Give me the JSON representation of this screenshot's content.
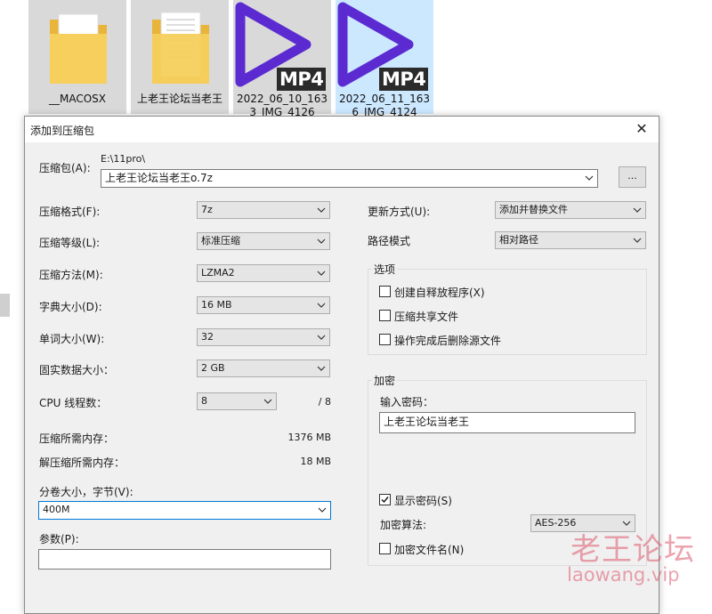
{
  "explorer": {
    "files": [
      {
        "name": "__MACOSX",
        "type": "folder-icon"
      },
      {
        "name": "上老王论坛当老王",
        "type": "folder-icon"
      },
      {
        "name": "2022_06_10_1633_IMG_4126",
        "type": "video-file-icon",
        "badge": "MP4"
      },
      {
        "name": "2022_06_11_1636_IMG_4124",
        "type": "video-file-icon",
        "badge": "MP4"
      }
    ]
  },
  "dialog": {
    "title": "添加到压缩包",
    "close_glyph": "✕",
    "archive": {
      "label": "压缩包(A):",
      "path": "E:\\11pro\\",
      "filename": "上老王论坛当老王o.7z",
      "browse_label": "..."
    },
    "left": {
      "format": {
        "label": "压缩格式(F):",
        "value": "7z"
      },
      "level": {
        "label": "压缩等级(L):",
        "value": "标准压缩"
      },
      "method": {
        "label": "压缩方法(M):",
        "value": "LZMA2"
      },
      "dict": {
        "label": "字典大小(D):",
        "value": "16 MB"
      },
      "word": {
        "label": "单词大小(W):",
        "value": "32"
      },
      "solid": {
        "label": "固实数据大小：",
        "value": "2 GB"
      },
      "threads": {
        "label": "CPU 线程数：",
        "value": "8",
        "max": "/ 8"
      },
      "mem_compress": {
        "label": "压缩所需内存：",
        "value": "1376 MB"
      },
      "mem_decompress": {
        "label": "解压缩所需内存：",
        "value": "18 MB"
      },
      "split": {
        "label": "分卷大小，字节(V):",
        "value": "400M"
      },
      "params": {
        "label": "参数(P):",
        "value": ""
      }
    },
    "right": {
      "update": {
        "label": "更新方式(U):",
        "value": "添加并替换文件"
      },
      "path_mode": {
        "label": "路径模式",
        "value": "相对路径"
      },
      "options": {
        "title": "选项",
        "items": [
          {
            "label": "创建自释放程序(X)",
            "checked": false
          },
          {
            "label": "压缩共享文件",
            "checked": false
          },
          {
            "label": "操作完成后删除源文件",
            "checked": false
          }
        ]
      },
      "encryption": {
        "title": "加密",
        "password_label": "输入密码：",
        "password": "上老王论坛当老王",
        "show_password": {
          "label": "显示密码(S)",
          "checked": true
        },
        "method_label": "加密算法:",
        "method_value": "AES-256",
        "encrypt_names": {
          "label": "加密文件名(N)",
          "checked": false
        }
      }
    }
  },
  "watermark": {
    "cn": "老王论坛",
    "en": "laowang.vip"
  },
  "colors": {
    "play_purple": "#5b2bd1",
    "folder_yellow": "#f4c542",
    "selection": "#cce8ff",
    "focus_border": "#0078d7"
  }
}
